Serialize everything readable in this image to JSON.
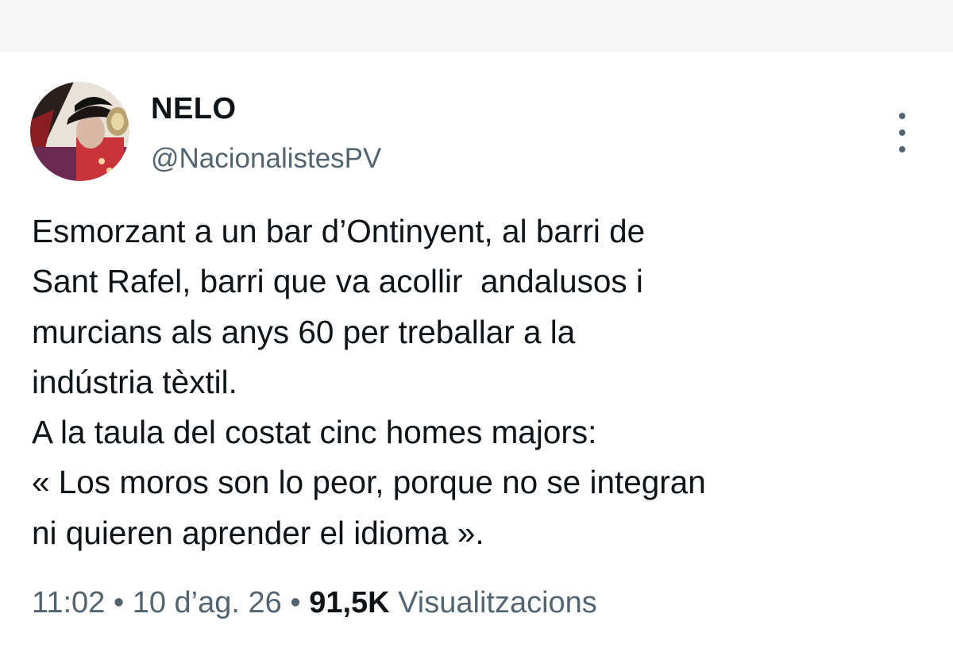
{
  "tweet": {
    "author": {
      "display_name": "NELO",
      "handle": "@NacionalistesPV"
    },
    "more_icon": "more-vertical-icon",
    "text_lines": [
      "Esmorzant a un bar d’Ontinyent, al barri de",
      "Sant Rafel, barri que va acollir  andalusos i",
      "murcians als anys 60 per treballar a la",
      "indústria tèxtil.",
      "A la taula del costat cinc homes majors:",
      "« Los moros son lo peor, porque no se integran",
      "ni quieren aprender el idioma »."
    ],
    "meta": {
      "time": "11:02",
      "separator": " • ",
      "date": "10 d’ag. 26",
      "views_count": "91,5K",
      "views_label": " Visualitzacions"
    },
    "colors": {
      "text_primary": "#0f1419",
      "text_secondary": "#536471",
      "background": "#ffffff",
      "top_strip": "#f7f7f7"
    }
  }
}
